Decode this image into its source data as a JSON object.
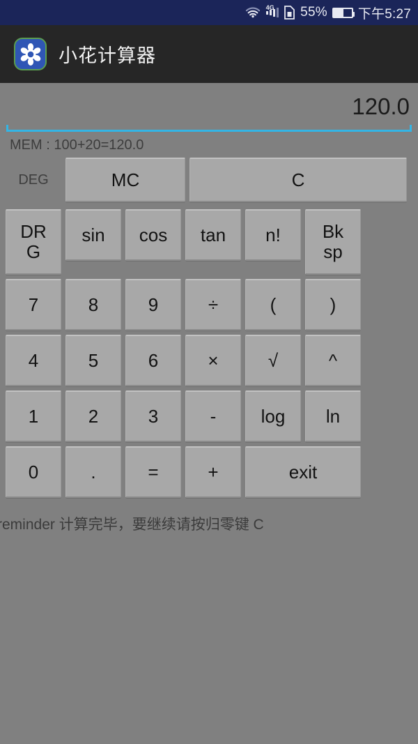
{
  "status_bar": {
    "wifi_icon": "wifi-icon",
    "network_label": "4G",
    "sim_icon": "sim-card-icon",
    "battery_percent": "55%",
    "battery_level": 55,
    "time": "下午5:27",
    "background_color": "#1b2559",
    "text_color": "#e8eaf2"
  },
  "title_bar": {
    "app_icon": "flower-app-icon",
    "title": "小花计算器",
    "background_color": "#262626"
  },
  "display": {
    "value": "120.0",
    "underline_color": "#33b5e5",
    "memory_line": "MEM : 100+20=120.0",
    "angle_mode": "DEG"
  },
  "mem_row": {
    "mc_label": "MC",
    "clear_label": "C"
  },
  "keypad": {
    "rows": [
      [
        {
          "label": "DRG",
          "name": "drg-button",
          "tall": true
        },
        {
          "label": "sin",
          "name": "sin-button"
        },
        {
          "label": "cos",
          "name": "cos-button"
        },
        {
          "label": "tan",
          "name": "tan-button"
        },
        {
          "label": "n!",
          "name": "factorial-button"
        },
        {
          "label": "Bksp",
          "name": "backspace-button",
          "tall": true
        }
      ],
      [
        {
          "label": "7",
          "name": "digit-7-button"
        },
        {
          "label": "8",
          "name": "digit-8-button"
        },
        {
          "label": "9",
          "name": "digit-9-button"
        },
        {
          "label": "÷",
          "name": "divide-button"
        },
        {
          "label": "(",
          "name": "left-paren-button"
        },
        {
          "label": ")",
          "name": "right-paren-button"
        }
      ],
      [
        {
          "label": "4",
          "name": "digit-4-button"
        },
        {
          "label": "5",
          "name": "digit-5-button"
        },
        {
          "label": "6",
          "name": "digit-6-button"
        },
        {
          "label": "×",
          "name": "multiply-button"
        },
        {
          "label": "√",
          "name": "sqrt-button"
        },
        {
          "label": "^",
          "name": "power-button"
        }
      ],
      [
        {
          "label": "1",
          "name": "digit-1-button"
        },
        {
          "label": "2",
          "name": "digit-2-button"
        },
        {
          "label": "3",
          "name": "digit-3-button"
        },
        {
          "label": "-",
          "name": "minus-button"
        },
        {
          "label": "log",
          "name": "log-button"
        },
        {
          "label": "ln",
          "name": "ln-button"
        }
      ],
      [
        {
          "label": "0",
          "name": "digit-0-button"
        },
        {
          "label": ".",
          "name": "decimal-point-button"
        },
        {
          "label": "=",
          "name": "equals-button"
        },
        {
          "label": "+",
          "name": "plus-button"
        },
        {
          "label": "exit",
          "name": "exit-button",
          "wide": true
        }
      ]
    ]
  },
  "reminder": {
    "text": "reminder 计算完毕，要继续请按归零键 C",
    "second_line": ":"
  },
  "colors": {
    "page_background": "#808080",
    "button_face": "#a8a8a8",
    "accent": "#33b5e5"
  }
}
